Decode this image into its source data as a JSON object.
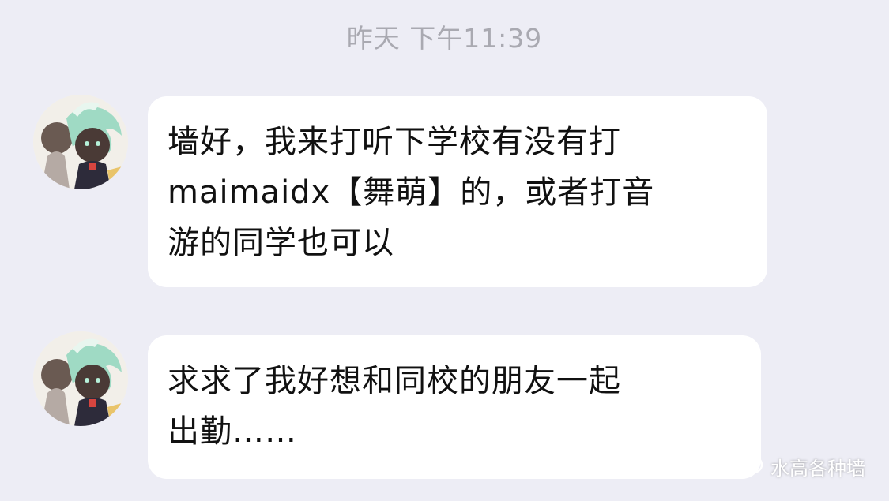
{
  "chat": {
    "timestamp": "昨天 下午11:39",
    "messages": [
      {
        "sender_avatar": "avatar-anime-character",
        "text": "墙好，我来打听下学校有没有打\nmaimaidx【舞萌】的，或者打音\n游的同学也可以"
      },
      {
        "sender_avatar": "avatar-anime-character",
        "text": "求求了我好想和同校的朋友一起\n出勤……"
      }
    ]
  },
  "watermark": {
    "label": "水高各种墙",
    "icon": "wechat-channel-icon"
  },
  "colors": {
    "background": "#ededf5",
    "bubble": "#ffffff",
    "text": "#111111",
    "timestamp": "#a9a9b1"
  }
}
